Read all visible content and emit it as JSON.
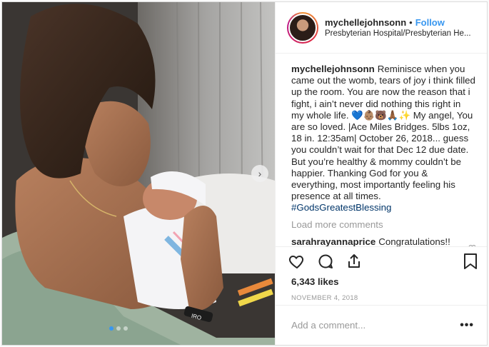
{
  "post": {
    "username": "mychellejohnsonn",
    "bullet": "•",
    "follow_label": "Follow",
    "location": "Presbyterian Hospital/Presbyterian He...",
    "caption": {
      "username": "mychellejohnsonn",
      "text": "Reminisce when you came out the womb, tears of joy i think filled up the room. You are now the reason that i fight, i ain’t never did nothing this right in my whole life. 💙👶🏽🐻🙏🏾✨ My angel, You are so loved. |Ace Miles Bridges. 5lbs 1oz, 18 in. 12:35am| October 26, 2018... guess you couldn’t wait for that Dec 12 due date. But you’re healthy & mommy couldn’t be happier. Thanking God for you & everything, most importantly feeling his presence at all times.",
      "hashtag": "#GodsGreatestBlessing"
    },
    "load_more": "Load more comments",
    "comment": {
      "username": "sarahrayannaprice",
      "text": "Congratulations!! Love you!! ❤️❤️"
    },
    "likes": "6,343 likes",
    "date": "NOVEMBER 4, 2018",
    "add_comment_placeholder": "Add a comment...",
    "more_label": "•••"
  },
  "photo": {
    "next_arrow": "›",
    "carousel_count": 3,
    "carousel_active": 1,
    "wristband_text": "IRO"
  },
  "icons": {
    "like": "heart-icon",
    "comment": "comment-bubble-icon",
    "share": "share-icon",
    "save": "bookmark-icon",
    "next": "chevron-right-icon"
  },
  "colors": {
    "accent": "#3897f0",
    "hashtag": "#003569",
    "muted": "#999999",
    "border": "#dbdbdb"
  }
}
